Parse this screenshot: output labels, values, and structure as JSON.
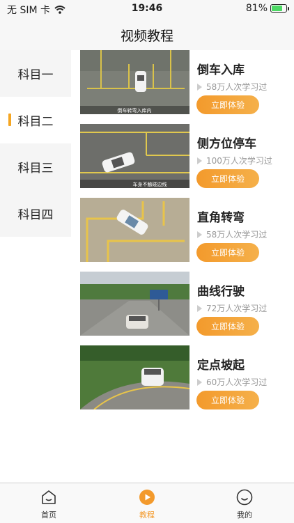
{
  "status": {
    "carrier": "无 SIM 卡",
    "time": "19:46",
    "battery": "81%",
    "battery_level": 0.81
  },
  "nav": {
    "title": "视频教程"
  },
  "sidebar": {
    "items": [
      {
        "label": "科目一"
      },
      {
        "label": "科目二"
      },
      {
        "label": "科目三"
      },
      {
        "label": "科目四"
      }
    ],
    "active_index": 1
  },
  "lessons": [
    {
      "title": "倒车入库",
      "learners": "58万人次学习过",
      "button": "立即体验",
      "caption": "倒车转弯入库内"
    },
    {
      "title": "侧方位停车",
      "learners": "100万人次学习过",
      "button": "立即体验",
      "caption": "车身不触碰边线"
    },
    {
      "title": "直角转弯",
      "learners": "58万人次学习过",
      "button": "立即体验",
      "caption": ""
    },
    {
      "title": "曲线行驶",
      "learners": "72万人次学习过",
      "button": "立即体验",
      "caption": ""
    },
    {
      "title": "定点坡起",
      "learners": "60万人次学习过",
      "button": "立即体验",
      "caption": ""
    }
  ],
  "tabbar": {
    "items": [
      {
        "label": "首页",
        "icon": "home-icon"
      },
      {
        "label": "教程",
        "icon": "play-circle-icon"
      },
      {
        "label": "我的",
        "icon": "smile-icon"
      }
    ],
    "active_index": 1
  },
  "colors": {
    "accent": "#f39a2c",
    "sidebar_bg": "#f5f5f5",
    "battery_green": "#4cd964"
  }
}
